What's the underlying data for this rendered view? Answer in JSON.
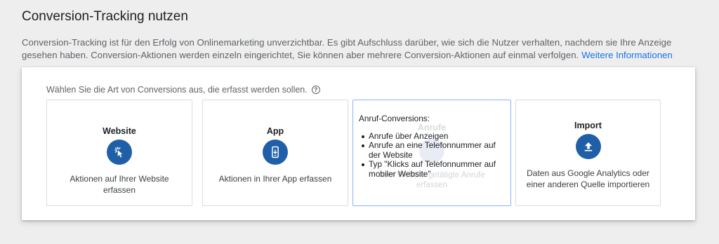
{
  "page": {
    "title": "Conversion-Tracking nutzen",
    "intro": "Conversion-Tracking ist für den Erfolg von Onlinemarketing unverzichtbar. Es gibt Aufschluss darüber, wie sich die Nutzer verhalten, nachdem sie Ihre Anzeige gesehen haben. Conversion-Aktionen werden einzeln eingerichtet, Sie können aber mehrere Conversion-Aktionen auf einmal verfolgen.",
    "learn_more": "Weitere Informationen"
  },
  "panel": {
    "prompt": "Wählen Sie die Art von Conversions aus, die erfasst werden sollen.",
    "help_icon": "help-circle-icon"
  },
  "cards": [
    {
      "title": "Website",
      "icon": "cursor-click-icon",
      "description": "Aktionen auf Ihrer Website erfassen"
    },
    {
      "title": "App",
      "icon": "smartphone-download-icon",
      "description": "Aktionen in Ihrer App erfassen"
    },
    {
      "title": "Anrufe",
      "icon": "phone-icon",
      "description": "oder Website getätigte Anrufe erfassen",
      "tooltip": {
        "heading": "Anruf-Conversions:",
        "items": [
          "Anrufe über Anzeigen",
          "Anrufe an eine Telefonnummer auf der Website",
          "Typ \"Klicks auf Telefonnummer auf mobiler Website\""
        ]
      }
    },
    {
      "title": "Import",
      "icon": "upload-icon",
      "description": "Daten aus Google Analytics oder einer anderen Quelle importieren"
    }
  ],
  "colors": {
    "accent": "#1f5fa8",
    "link": "#1a73e8",
    "background": "#eeeeee",
    "selected_border": "#8ab4f8"
  }
}
